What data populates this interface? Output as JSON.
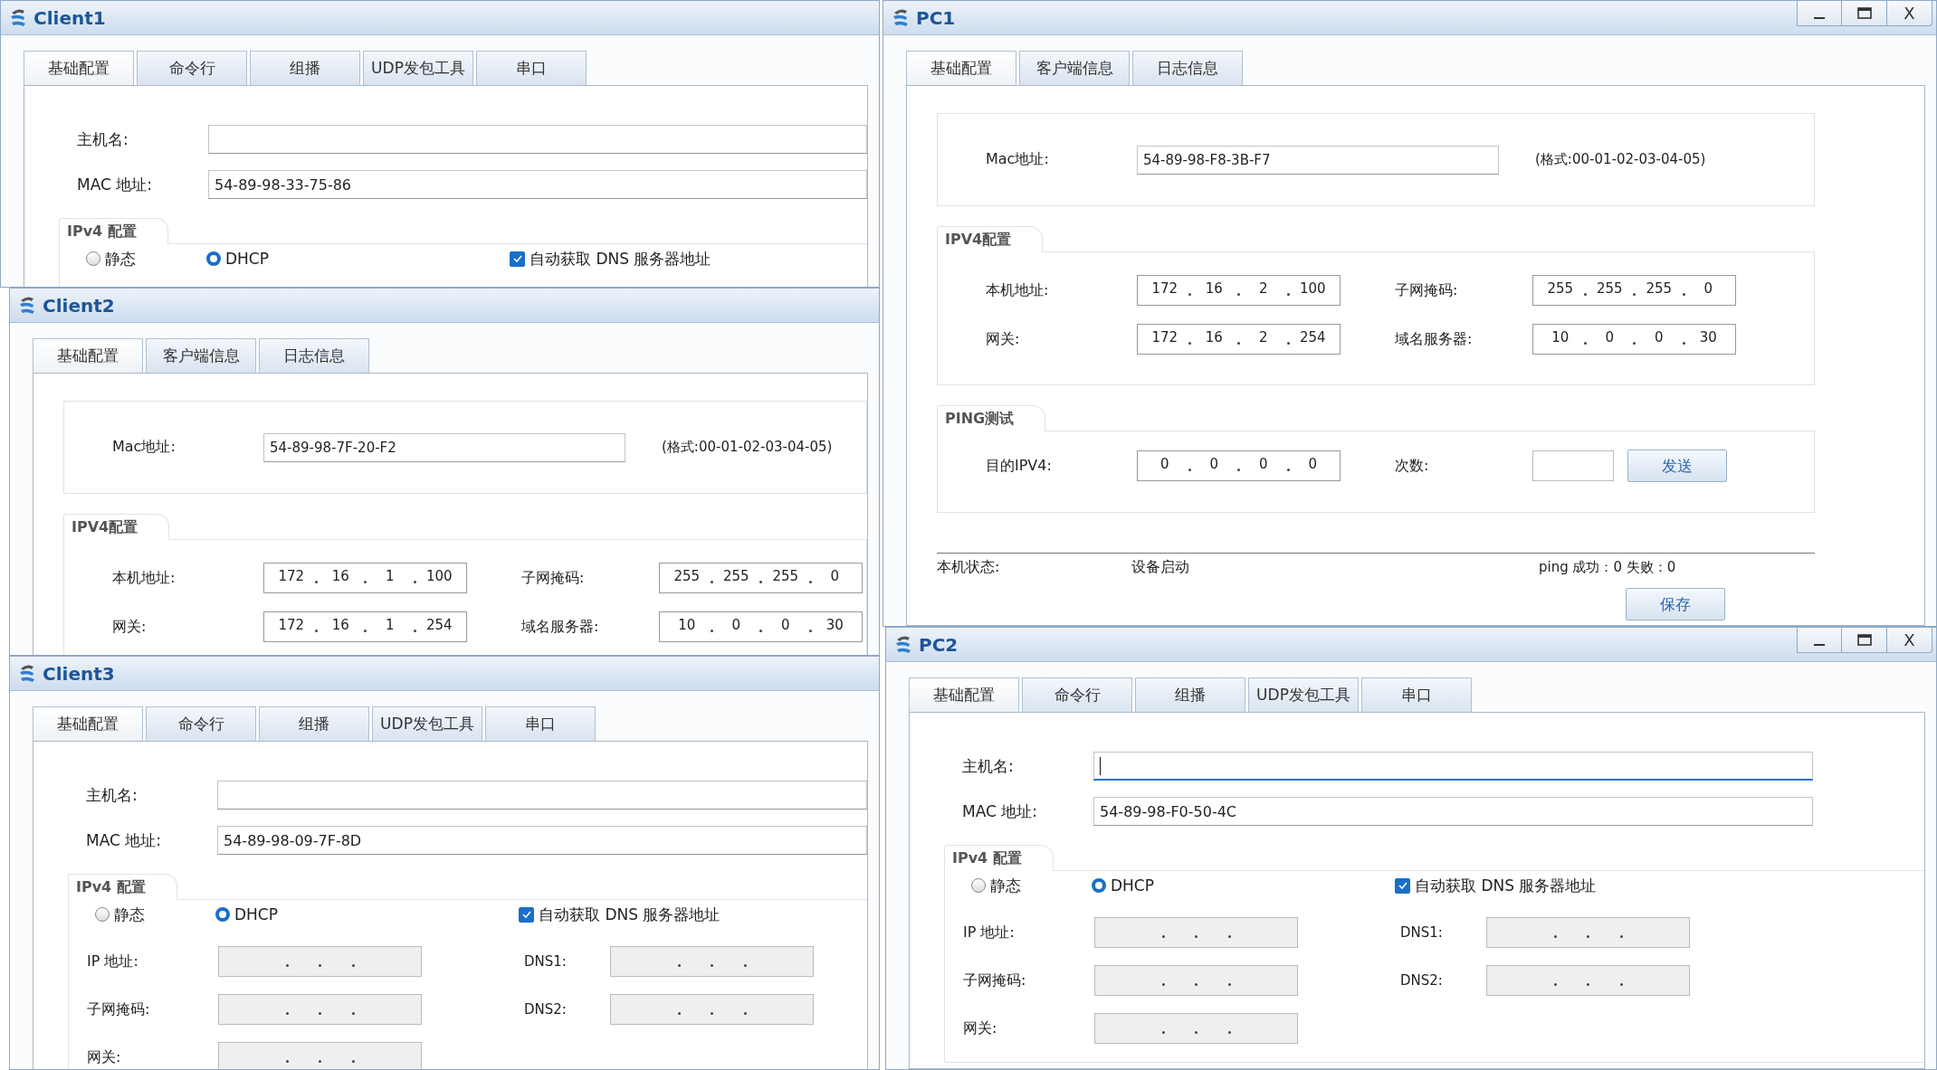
{
  "windows": [
    {
      "kind": "host",
      "title": "Client1",
      "tabs": [
        {
          "label": "基础配置",
          "selected": true
        },
        {
          "label": "命令行",
          "selected": false
        },
        {
          "label": "组播",
          "selected": false
        },
        {
          "label": "UDP发包工具",
          "selected": false
        },
        {
          "label": "串口",
          "selected": false
        }
      ],
      "hostname": {
        "label": "主机名:",
        "focused": false
      },
      "mac": {
        "label": "MAC 地址:",
        "value": "54-89-98-33-75-86"
      },
      "ipv4": {
        "legend": "IPv4 配置",
        "static": {
          "label": "静态",
          "selected": false
        },
        "dhcp": {
          "label": "DHCP",
          "selected": true
        },
        "dns_auto": {
          "label": "自动获取 DNS 服务器地址",
          "checked": true
        }
      }
    },
    {
      "kind": "server",
      "title": "Client2",
      "tabs": [
        {
          "label": "基础配置",
          "selected": true
        },
        {
          "label": "客户端信息",
          "selected": false
        },
        {
          "label": "日志信息",
          "selected": false
        }
      ],
      "mac": {
        "label": "Mac地址:",
        "value": "54-89-98-7F-20-F2",
        "hint": "(格式:00-01-02-03-04-05)"
      },
      "ipv4": {
        "legend": "IPV4配置",
        "fields": [
          {
            "label": "本机地址:",
            "octets": [
              "172",
              "16",
              "1",
              "100"
            ]
          },
          {
            "label": "子网掩码:",
            "octets": [
              "255",
              "255",
              "255",
              "0"
            ]
          },
          {
            "label": "网关:",
            "octets": [
              "172",
              "16",
              "1",
              "254"
            ]
          },
          {
            "label": "域名服务器:",
            "octets": [
              "10",
              "0",
              "0",
              "30"
            ]
          }
        ]
      }
    },
    {
      "kind": "host",
      "title": "Client3",
      "tabs": [
        {
          "label": "基础配置",
          "selected": true
        },
        {
          "label": "命令行",
          "selected": false
        },
        {
          "label": "组播",
          "selected": false
        },
        {
          "label": "UDP发包工具",
          "selected": false
        },
        {
          "label": "串口",
          "selected": false
        }
      ],
      "hostname": {
        "label": "主机名:",
        "focused": false
      },
      "mac": {
        "label": "MAC 地址:",
        "value": "54-89-98-09-7F-8D"
      },
      "ipv4": {
        "legend": "IPv4 配置",
        "static": {
          "label": "静态",
          "selected": false
        },
        "dhcp": {
          "label": "DHCP",
          "selected": true
        },
        "dns_auto": {
          "label": "自动获取 DNS 服务器地址",
          "checked": true
        },
        "rows": [
          {
            "label": "IP 地址:",
            "disabled": true,
            "side": {
              "label": "DNS1:",
              "disabled": true
            }
          },
          {
            "label": "子网掩码:",
            "disabled": true,
            "side": {
              "label": "DNS2:",
              "disabled": true
            }
          },
          {
            "label": "网关:",
            "disabled": true
          }
        ]
      }
    },
    {
      "kind": "server",
      "title": "PC1",
      "close": "X",
      "tabs": [
        {
          "label": "基础配置",
          "selected": true
        },
        {
          "label": "客户端信息",
          "selected": false
        },
        {
          "label": "日志信息",
          "selected": false
        }
      ],
      "mac": {
        "label": "Mac地址:",
        "value": "54-89-98-F8-3B-F7",
        "hint": "(格式:00-01-02-03-04-05)"
      },
      "ipv4": {
        "legend": "IPV4配置",
        "fields": [
          {
            "label": "本机地址:",
            "octets": [
              "172",
              "16",
              "2",
              "100"
            ]
          },
          {
            "label": "子网掩码:",
            "octets": [
              "255",
              "255",
              "255",
              "0"
            ]
          },
          {
            "label": "网关:",
            "octets": [
              "172",
              "16",
              "2",
              "254"
            ]
          },
          {
            "label": "域名服务器:",
            "octets": [
              "10",
              "0",
              "0",
              "30"
            ]
          }
        ]
      },
      "ping": {
        "legend": "PING测试",
        "target_label": "目的IPV4:",
        "octets": [
          "0",
          "0",
          "0",
          "0"
        ],
        "count_label": "次数:",
        "send": "发送"
      },
      "status": {
        "label": "本机状态:",
        "value": "设备启动",
        "result": "ping 成功：0 失败：0"
      },
      "save": "保存"
    },
    {
      "kind": "host",
      "title": "PC2",
      "close": "X",
      "tabs": [
        {
          "label": "基础配置",
          "selected": true
        },
        {
          "label": "命令行",
          "selected": false
        },
        {
          "label": "组播",
          "selected": false
        },
        {
          "label": "UDP发包工具",
          "selected": false
        },
        {
          "label": "串口",
          "selected": false
        }
      ],
      "hostname": {
        "label": "主机名:",
        "focused": true
      },
      "mac": {
        "label": "MAC 地址:",
        "value": "54-89-98-F0-50-4C"
      },
      "ipv4": {
        "legend": "IPv4 配置",
        "static": {
          "label": "静态",
          "selected": false
        },
        "dhcp": {
          "label": "DHCP",
          "selected": true
        },
        "dns_auto": {
          "label": "自动获取 DNS 服务器地址",
          "checked": true
        },
        "rows": [
          {
            "label": "IP 地址:",
            "disabled": true,
            "side": {
              "label": "DNS1:",
              "disabled": true
            }
          },
          {
            "label": "子网掩码:",
            "disabled": true,
            "side": {
              "label": "DNS2:",
              "disabled": true
            }
          },
          {
            "label": "网关:",
            "disabled": true
          }
        ]
      }
    }
  ]
}
